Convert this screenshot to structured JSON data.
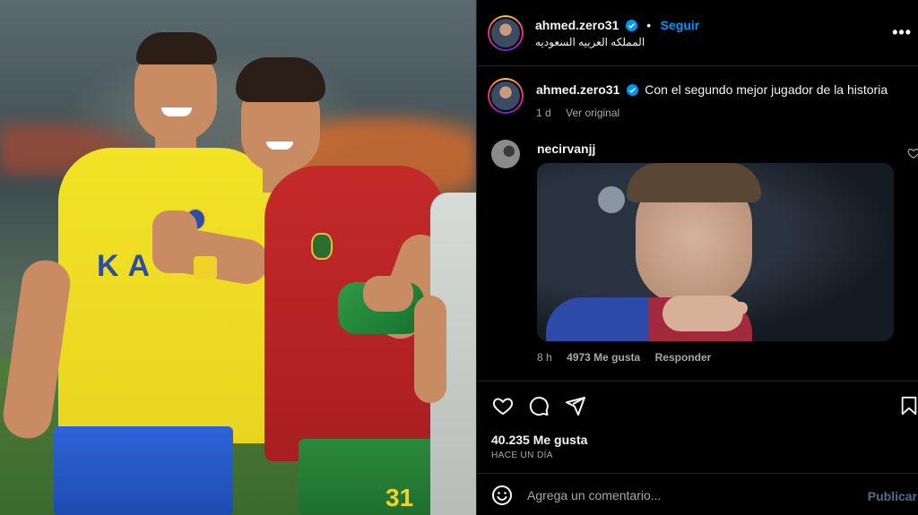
{
  "post": {
    "username": "ahmed.zero31",
    "follow_label": "Seguir",
    "location": "المملكه العربيه السعوديه",
    "more_label": "•••"
  },
  "caption": {
    "username": "ahmed.zero31",
    "text": "Con el segundo mejor jugador de la historia",
    "time": "1 d",
    "see_original": "Ver original"
  },
  "comment": {
    "username": "necirvanjj",
    "time": "8 h",
    "likes": "4973 Me gusta",
    "reply_label": "Responder"
  },
  "photo": {
    "shirt_left_text": "KA",
    "shorts_number": "31"
  },
  "actions": {
    "like_count": "40.235 Me gusta",
    "time_ago": "HACE UN DÍA"
  },
  "add_comment": {
    "placeholder": "Agrega un comentario...",
    "publish_label": "Publicar"
  },
  "colors": {
    "accent": "#0095f6",
    "background": "#000000",
    "muted_text": "#a8a8a8",
    "publish_disabled": "#4f6e8e"
  },
  "icons": [
    "verified-icon",
    "more-icon",
    "heart-icon",
    "comment-icon",
    "share-icon",
    "save-icon",
    "emoji-icon"
  ]
}
